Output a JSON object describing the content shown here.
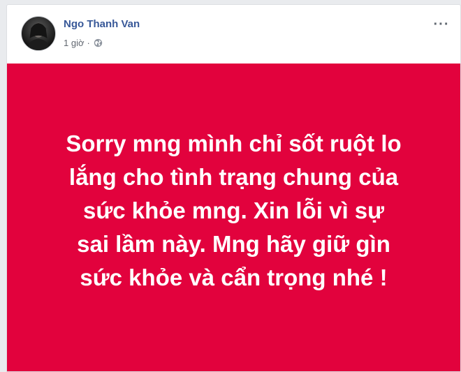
{
  "post": {
    "author_name": "Ngo Thanh Van",
    "timestamp": "1 giờ",
    "separator": "·",
    "privacy_icon": "globe-icon",
    "more_options": "···",
    "background_color": "#e2023d",
    "text_color": "#ffffff",
    "message_lines": [
      "Sorry mng mình chỉ sốt ruột lo",
      "lắng cho tình trạng chung của",
      "sức khỏe mng. Xin lỗi vì sự",
      "sai lầm này. Mng hãy giữ gìn",
      "sức khỏe và cẩn trọng nhé !"
    ]
  },
  "colors": {
    "author_link": "#385898",
    "meta_text": "#616770",
    "page_background": "#e9ebee"
  }
}
